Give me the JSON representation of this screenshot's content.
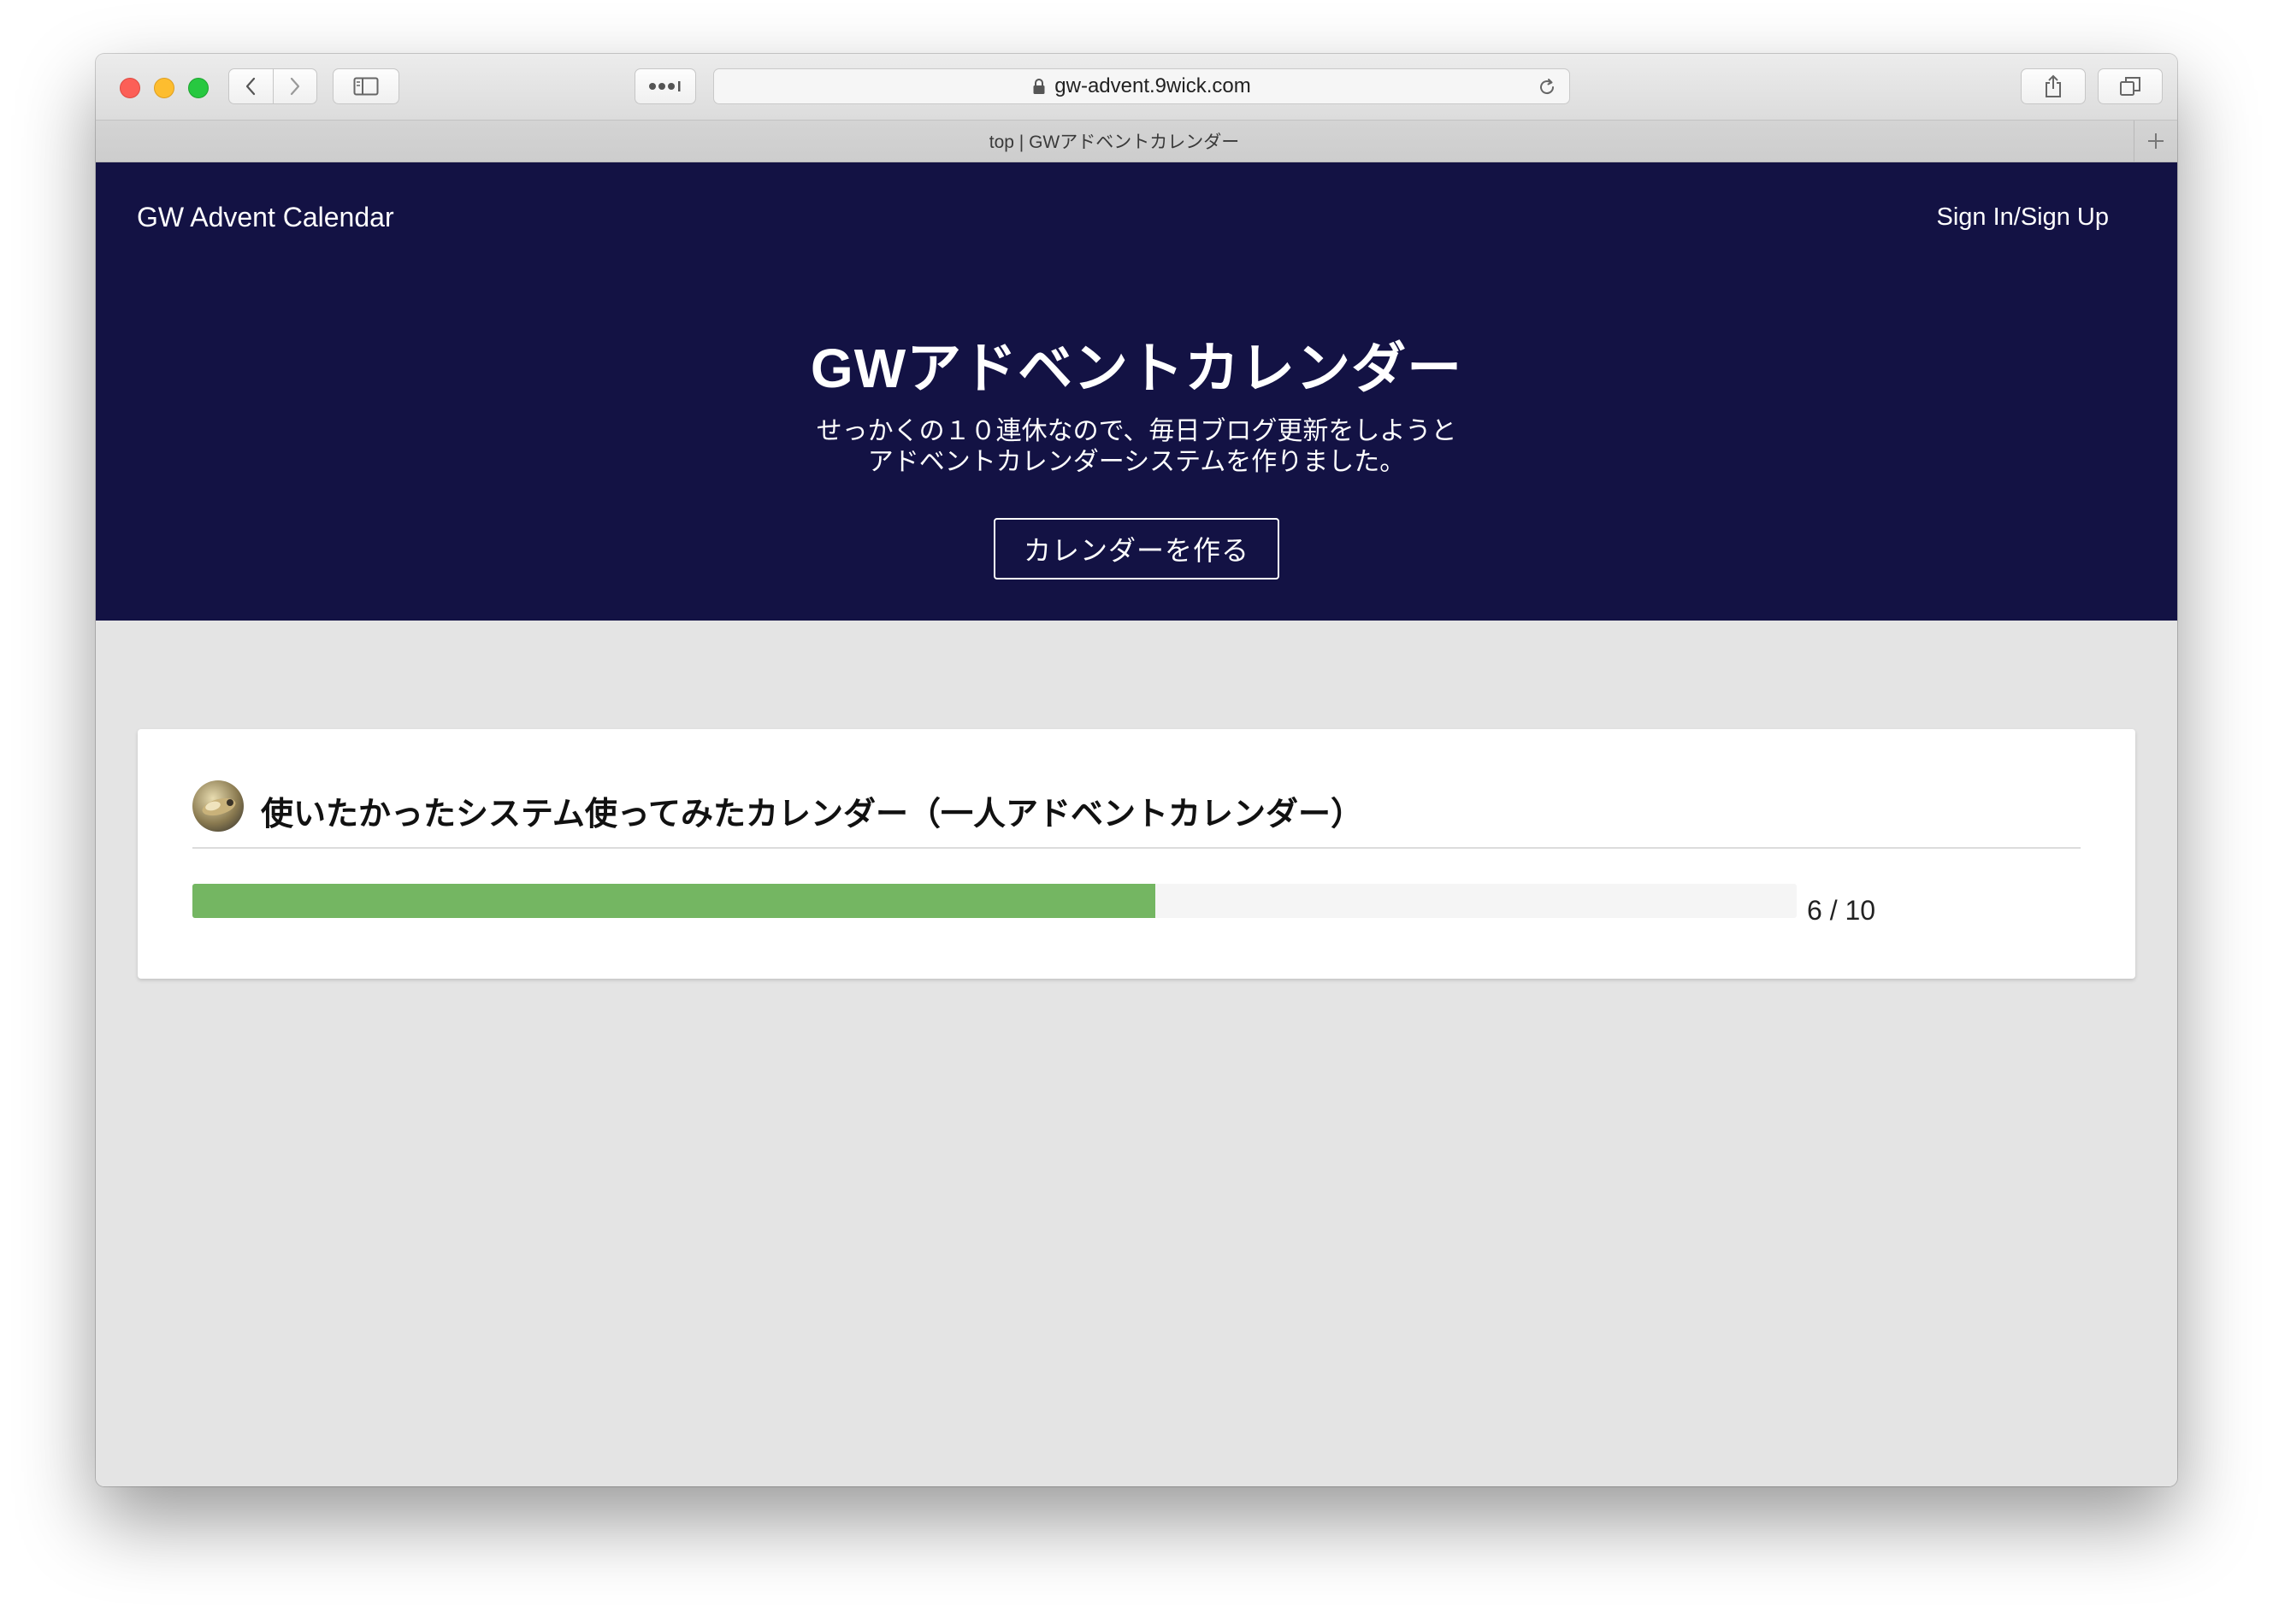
{
  "browser": {
    "url": "gw-advent.9wick.com",
    "tab_title": "top | GWアドベントカレンダー"
  },
  "header": {
    "brand": "GW Advent Calendar",
    "signin_label": "Sign In/Sign Up"
  },
  "hero": {
    "title": "GWアドベントカレンダー",
    "subtitle_line1": "せっかくの１０連休なので、毎日ブログ更新をしようと",
    "subtitle_line2": "アドベントカレンダーシステムを作りました。",
    "cta_label": "カレンダーを作る"
  },
  "calendars": [
    {
      "title": "使いたかったシステム使ってみたカレンダー（一人アドベントカレンダー）",
      "progress_current": 6,
      "progress_total": 10,
      "progress_text": "6 / 10"
    }
  ],
  "colors": {
    "hero_bg": "#131244",
    "progress_fill": "#74b662",
    "page_bg": "#e4e4e4"
  }
}
